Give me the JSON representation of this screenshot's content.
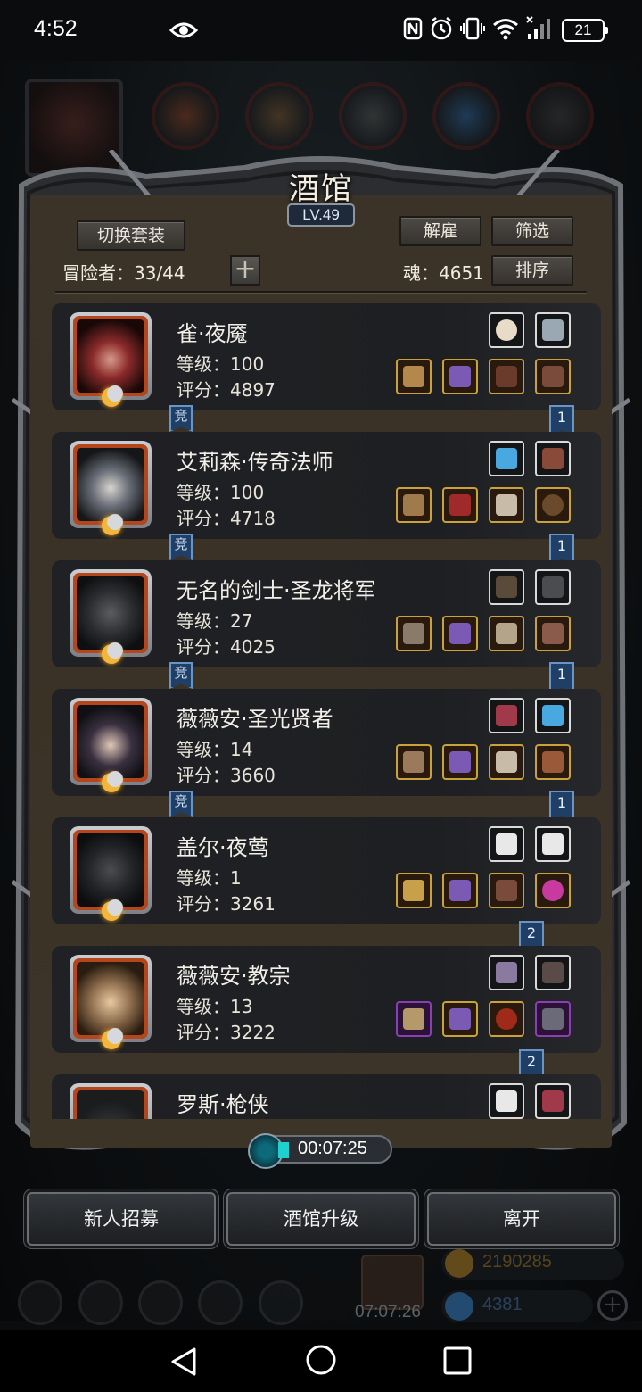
{
  "status_bar": {
    "time": "4:52",
    "battery": "21"
  },
  "tavern": {
    "title": "酒馆",
    "level": "LV.49",
    "switch_outfit_label": "切换套装",
    "dismiss_label": "解雇",
    "filter_label": "筛选",
    "sort_label": "排序",
    "adventurers_text": "冒险者：33/44",
    "soul_text": "魂：4651",
    "jing_label": "竞",
    "heroes": [
      {
        "name": "雀·夜魇",
        "level_text": "等级：100",
        "score_text": "评分：4897",
        "rank": "1",
        "has_jing": true
      },
      {
        "name": "艾莉森·传奇法师",
        "level_text": "等级：100",
        "score_text": "评分：4718",
        "rank": "1",
        "has_jing": true
      },
      {
        "name": "无名的剑士·圣龙将军",
        "level_text": "等级：27",
        "score_text": "评分：4025",
        "rank": "1",
        "has_jing": true
      },
      {
        "name": "薇薇安·圣光贤者",
        "level_text": "等级：14",
        "score_text": "评分：3660",
        "rank": "1",
        "has_jing": true
      },
      {
        "name": "盖尔·夜莺",
        "level_text": "等级：1",
        "score_text": "评分：3261",
        "rank": "2",
        "has_jing": false
      },
      {
        "name": "薇薇安·教宗",
        "level_text": "等级：13",
        "score_text": "评分：3222",
        "rank": "2",
        "has_jing": false
      },
      {
        "name": "罗斯·枪侠",
        "level_text": "",
        "score_text": "",
        "rank": "",
        "has_jing": false
      }
    ],
    "timer": "00:07:25",
    "recruit_label": "新人招募",
    "upgrade_label": "酒馆升级",
    "leave_label": "离开"
  },
  "background": {
    "event_timer": "07:07:26",
    "gold": "2190285",
    "gems": "4381"
  },
  "colors": {
    "panel_bg": "#3b3327",
    "card_bg": "#202124",
    "rank_ribbon": "#1f3f66",
    "slot_gold": "#c9a23a",
    "slot_purple": "#8b3fb4",
    "portrait_frame": "#b5451a"
  }
}
